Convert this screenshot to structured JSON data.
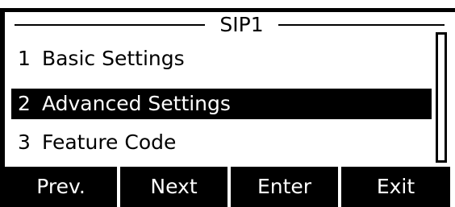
{
  "header": {
    "title": "SIP1"
  },
  "menu": {
    "items": [
      {
        "number": "1",
        "label": "Basic Settings",
        "selected": false
      },
      {
        "number": "2",
        "label": "Advanced Settings",
        "selected": true
      },
      {
        "number": "3",
        "label": "Feature Code",
        "selected": false
      }
    ]
  },
  "softkeys": [
    {
      "label": "Prev."
    },
    {
      "label": "Next"
    },
    {
      "label": "Enter"
    },
    {
      "label": "Exit"
    }
  ],
  "colors": {
    "background": "#ffffff",
    "foreground": "#000000",
    "selected_bg": "#000000",
    "selected_fg": "#ffffff"
  }
}
